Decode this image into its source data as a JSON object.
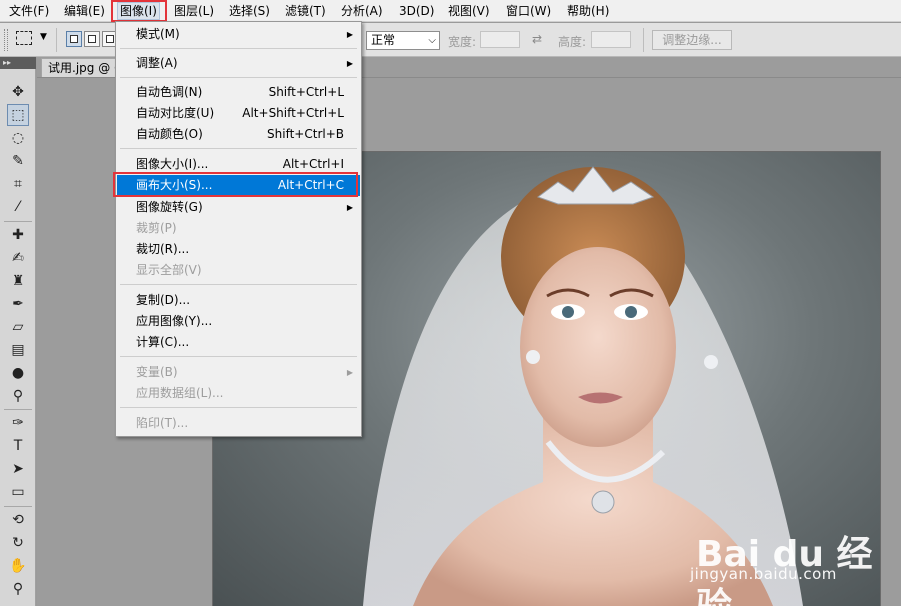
{
  "menubar": {
    "items": [
      "文件(F)",
      "编辑(E)",
      "图像(I)",
      "图层(L)",
      "选择(S)",
      "滤镜(T)",
      "分析(A)",
      "3D(D)",
      "视图(V)",
      "窗口(W)",
      "帮助(H)"
    ]
  },
  "options_bar": {
    "style_value": "正常",
    "width_label": "宽度:",
    "height_label": "高度:",
    "refine_edge_label": "调整边缘..."
  },
  "document": {
    "tab_title": "试用.jpg @ 6"
  },
  "toolbox": {
    "tools": [
      "move-icon",
      "marquee-icon",
      "lasso-icon",
      "quick-select-icon",
      "crop-icon",
      "eyedropper-icon",
      "healing-icon",
      "brush-icon",
      "clone-stamp-icon",
      "history-brush-icon",
      "eraser-icon",
      "gradient-icon",
      "blur-icon",
      "dodge-icon",
      "pen-icon",
      "type-icon",
      "path-select-icon",
      "rectangle-icon",
      "3d-rotate-icon",
      "3d-orbit-icon",
      "hand-icon",
      "zoom-icon"
    ]
  },
  "image_menu": {
    "items": [
      {
        "label": "模式(M)",
        "shortcut": "",
        "submenu": true,
        "disabled": false
      },
      {
        "label": "调整(A)",
        "shortcut": "",
        "submenu": true,
        "disabled": false
      },
      {
        "label": "自动色调(N)",
        "shortcut": "Shift+Ctrl+L",
        "submenu": false,
        "disabled": false
      },
      {
        "label": "自动对比度(U)",
        "shortcut": "Alt+Shift+Ctrl+L",
        "submenu": false,
        "disabled": false
      },
      {
        "label": "自动颜色(O)",
        "shortcut": "Shift+Ctrl+B",
        "submenu": false,
        "disabled": false
      },
      {
        "label": "图像大小(I)...",
        "shortcut": "Alt+Ctrl+I",
        "submenu": false,
        "disabled": false
      },
      {
        "label": "画布大小(S)...",
        "shortcut": "Alt+Ctrl+C",
        "submenu": false,
        "disabled": false,
        "selected": true
      },
      {
        "label": "图像旋转(G)",
        "shortcut": "",
        "submenu": true,
        "disabled": false
      },
      {
        "label": "裁剪(P)",
        "shortcut": "",
        "submenu": false,
        "disabled": true
      },
      {
        "label": "裁切(R)...",
        "shortcut": "",
        "submenu": false,
        "disabled": false
      },
      {
        "label": "显示全部(V)",
        "shortcut": "",
        "submenu": false,
        "disabled": true
      },
      {
        "label": "复制(D)...",
        "shortcut": "",
        "submenu": false,
        "disabled": false
      },
      {
        "label": "应用图像(Y)...",
        "shortcut": "",
        "submenu": false,
        "disabled": false
      },
      {
        "label": "计算(C)...",
        "shortcut": "",
        "submenu": false,
        "disabled": false
      },
      {
        "label": "变量(B)",
        "shortcut": "",
        "submenu": true,
        "disabled": true
      },
      {
        "label": "应用数据组(L)...",
        "shortcut": "",
        "submenu": false,
        "disabled": true
      },
      {
        "label": "陷印(T)...",
        "shortcut": "",
        "submenu": false,
        "disabled": true
      }
    ]
  },
  "watermark": {
    "brand": "Bai du 经验",
    "url": "jingyan.baidu.com"
  },
  "colors": {
    "highlight_box": "#e3343a",
    "menu_selection": "#0078d7"
  }
}
